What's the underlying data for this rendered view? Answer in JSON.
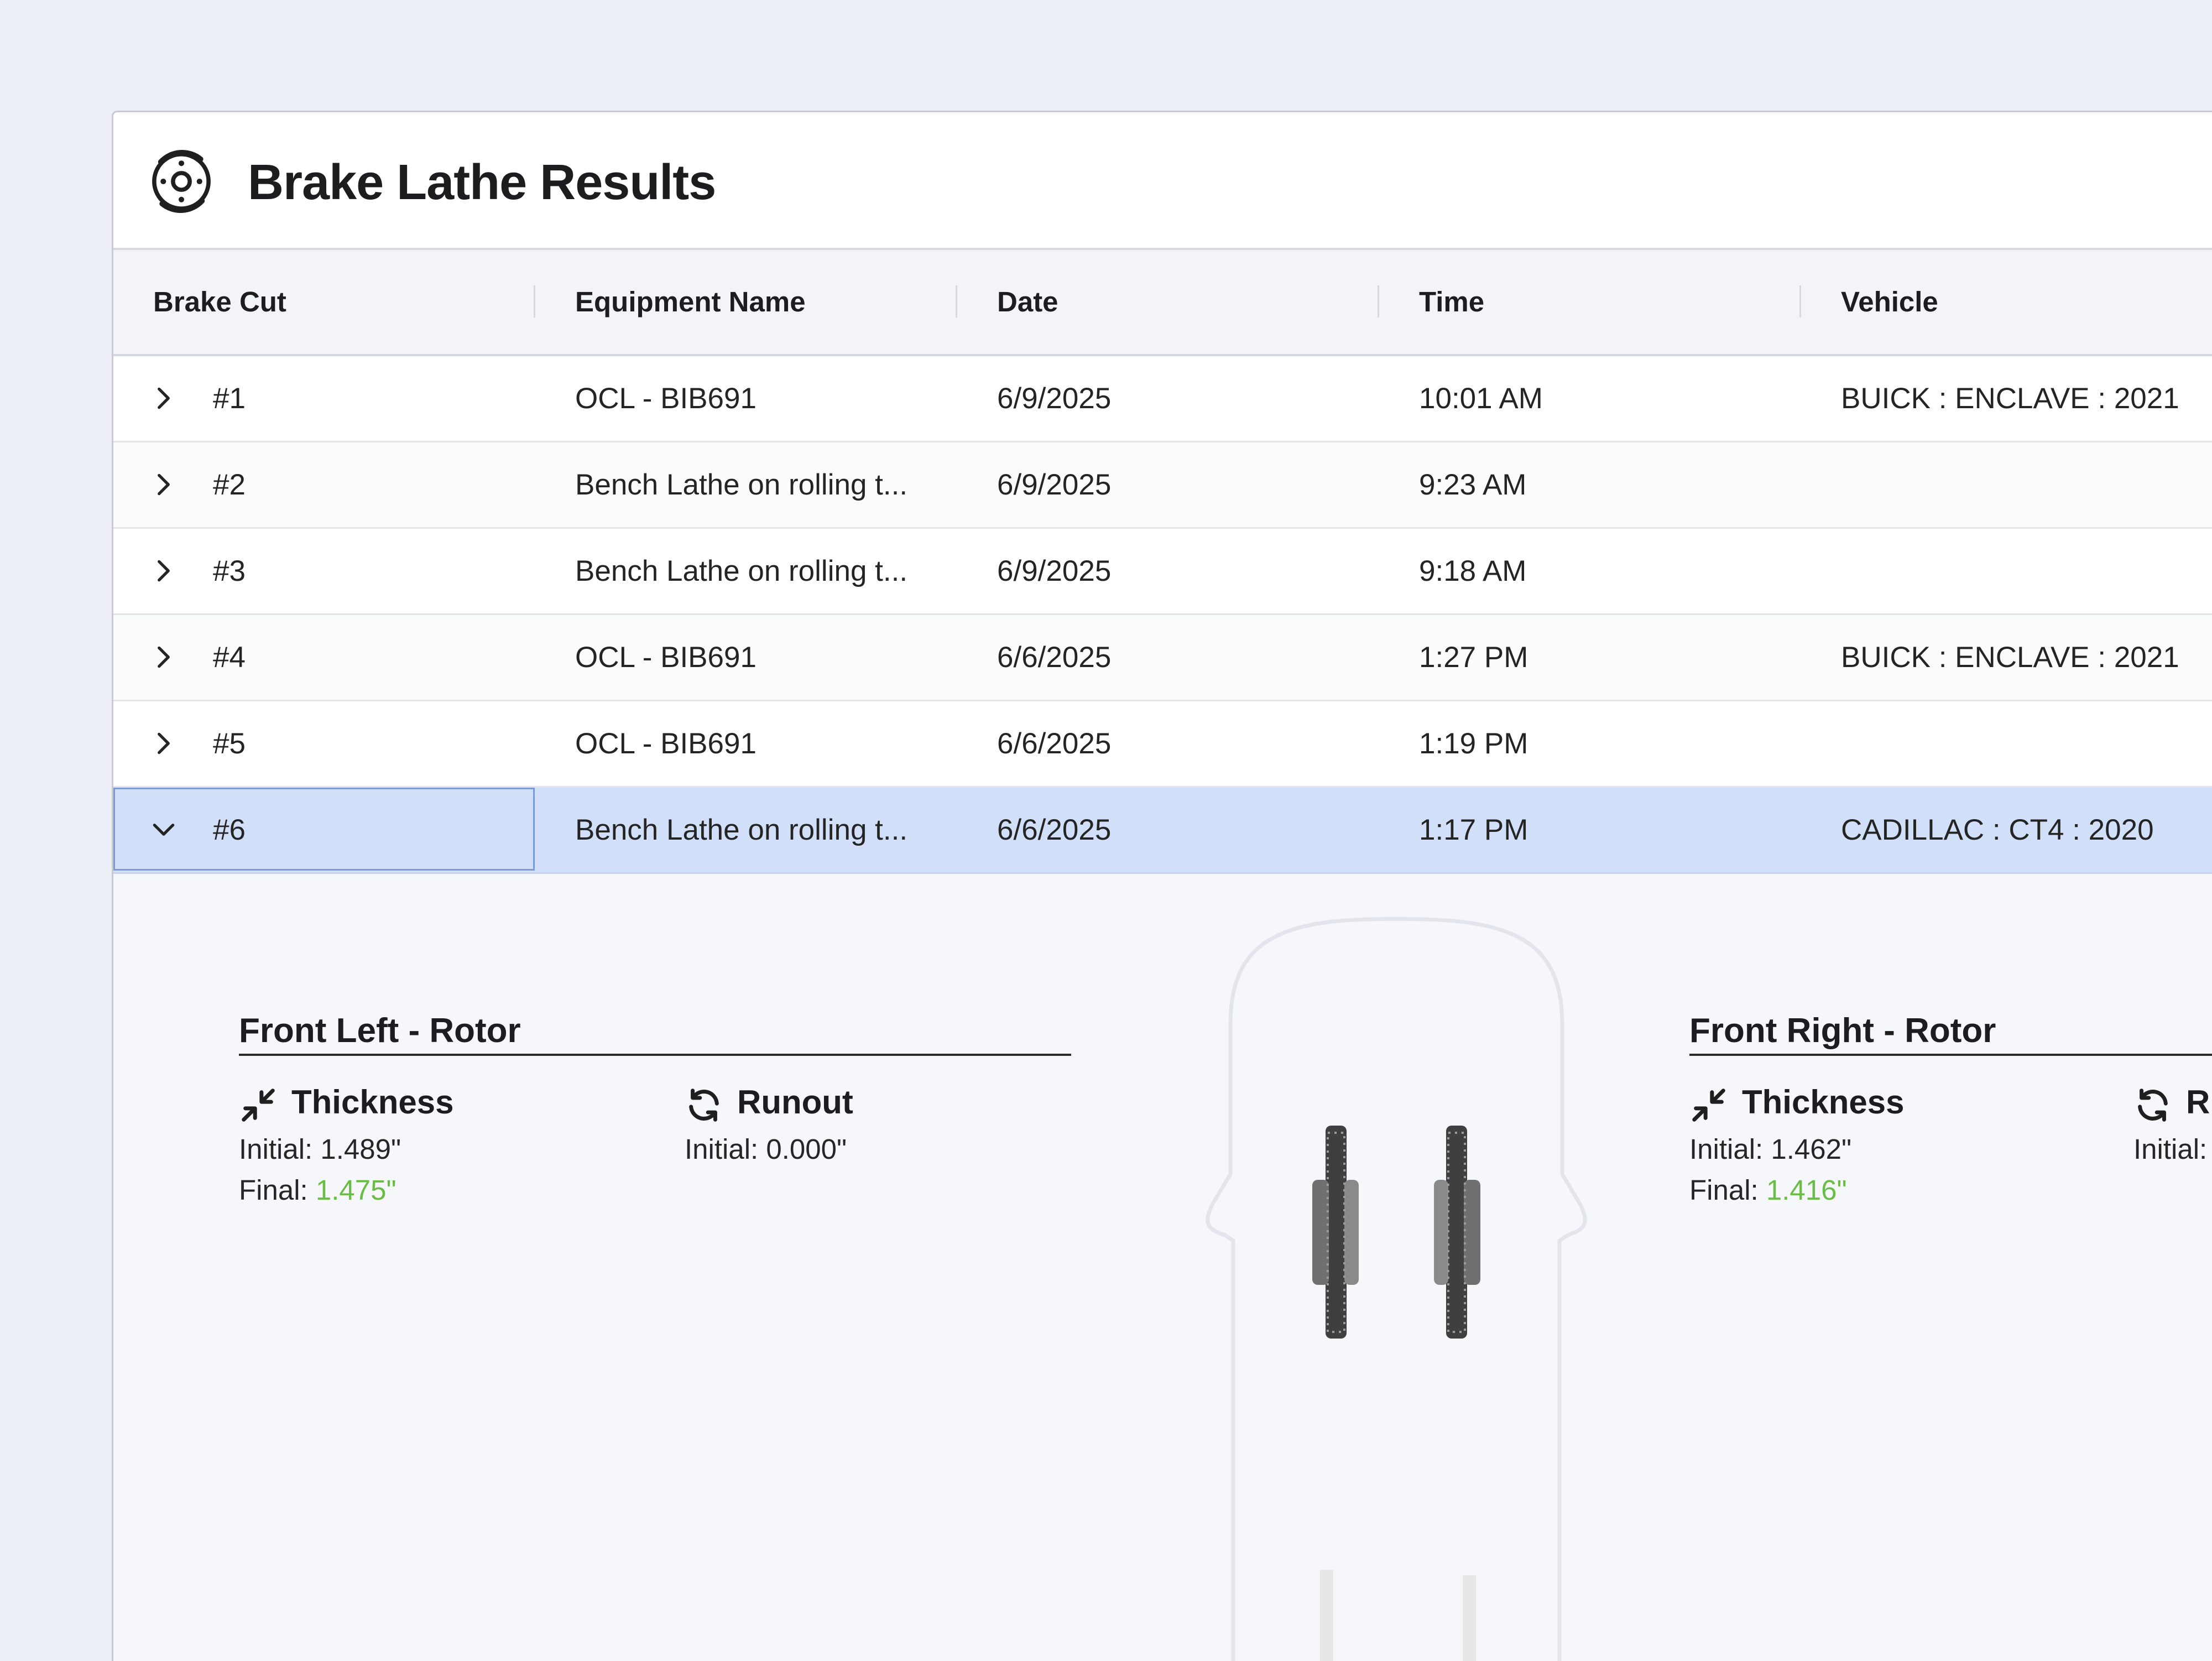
{
  "app": {
    "title": "Brake Lathe Results",
    "icon": "brake-rotor-icon"
  },
  "table": {
    "columns": [
      "Brake Cut",
      "Equipment Name",
      "Date",
      "Time",
      "Vehicle"
    ],
    "rows": [
      {
        "cut": "#1",
        "equipment": "OCL - BIB691",
        "date": "6/9/2025",
        "time": "10:01 AM",
        "vehicle": "BUICK : ENCLAVE : 2021",
        "expanded": false
      },
      {
        "cut": "#2",
        "equipment": "Bench Lathe on rolling t...",
        "date": "6/9/2025",
        "time": "9:23 AM",
        "vehicle": "",
        "expanded": false
      },
      {
        "cut": "#3",
        "equipment": "Bench Lathe on rolling t...",
        "date": "6/9/2025",
        "time": "9:18 AM",
        "vehicle": "",
        "expanded": false
      },
      {
        "cut": "#4",
        "equipment": "OCL - BIB691",
        "date": "6/6/2025",
        "time": "1:27 PM",
        "vehicle": "BUICK : ENCLAVE : 2021",
        "expanded": false
      },
      {
        "cut": "#5",
        "equipment": "OCL - BIB691",
        "date": "6/6/2025",
        "time": "1:19 PM",
        "vehicle": "",
        "expanded": false
      },
      {
        "cut": "#6",
        "equipment": "Bench Lathe on rolling t...",
        "date": "6/6/2025",
        "time": "1:17 PM",
        "vehicle": "CADILLAC : CT4 : 2020",
        "expanded": true
      }
    ]
  },
  "detail": {
    "front_left": {
      "title": "Front Left - Rotor",
      "thickness_label": "Thickness",
      "thickness_initial": "Initial: 1.489\"",
      "thickness_final_label": "Final: ",
      "thickness_final": "1.475\"",
      "runout_label": "Runout",
      "runout_initial": "Initial: 0.000\""
    },
    "front_right": {
      "title": "Front Right - Rotor",
      "thickness_label": "Thickness",
      "thickness_initial": "Initial: 1.462\"",
      "thickness_final_label": "Final: ",
      "thickness_final": "1.416\"",
      "runout_label": "Ru",
      "runout_initial": "Initial:"
    }
  },
  "colors": {
    "background": "#eceff6",
    "selected_row": "#d2dff8",
    "focus_border": "#7a9bd8",
    "good_value": "#69bd45"
  }
}
